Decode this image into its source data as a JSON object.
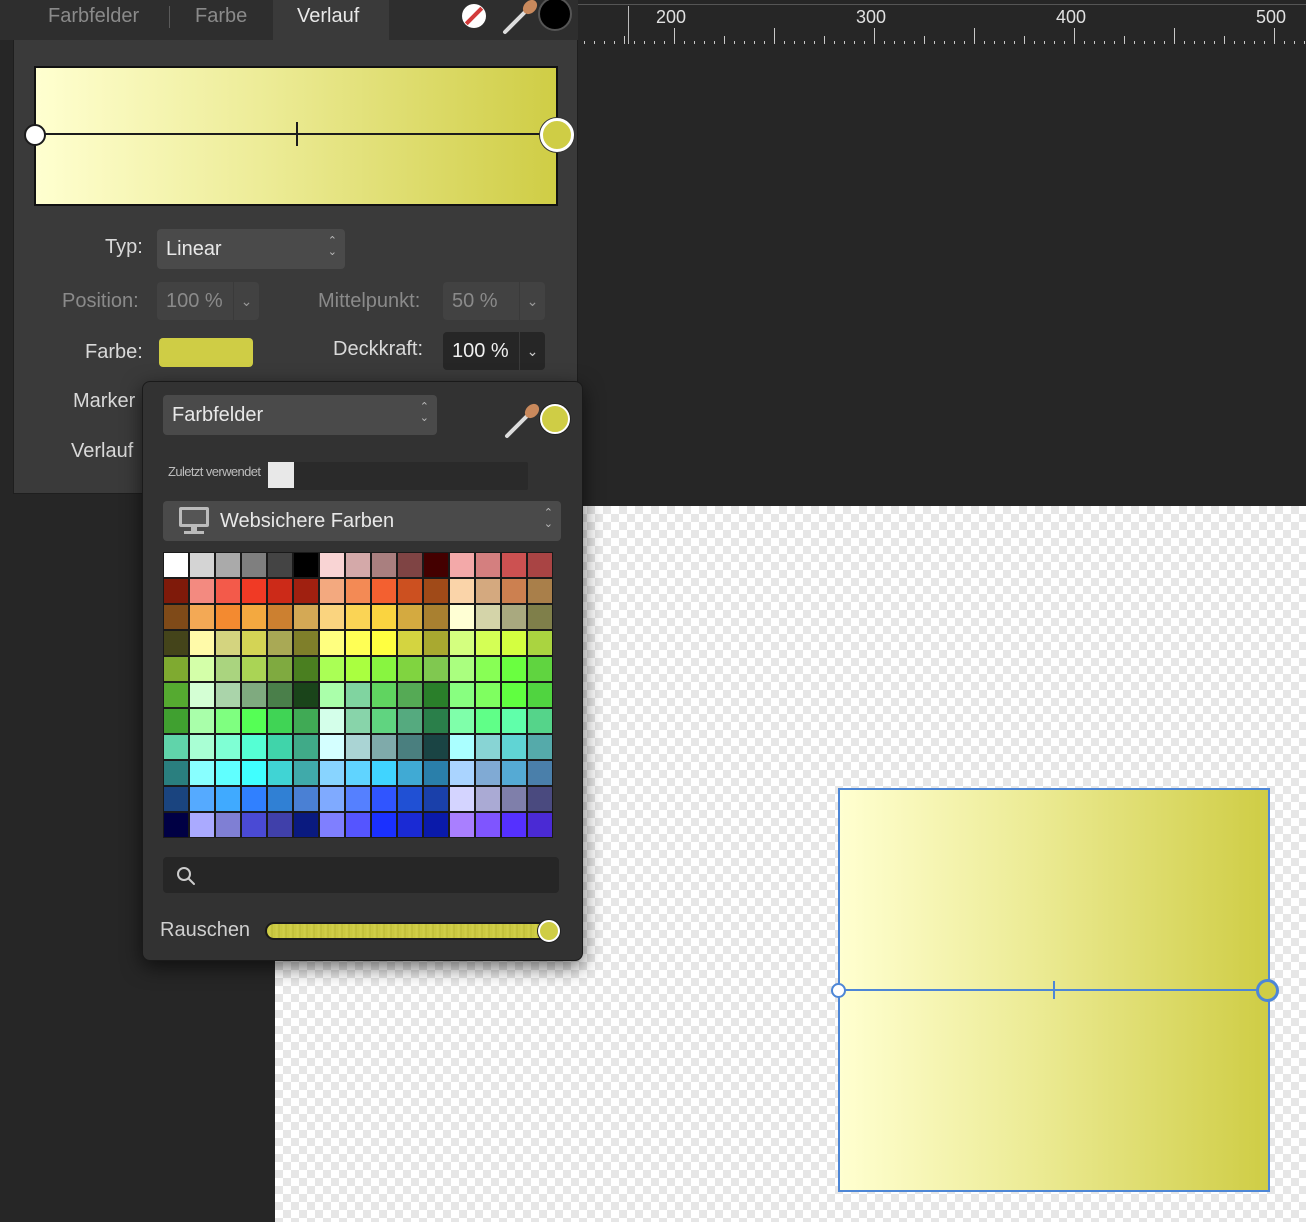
{
  "tabs": [
    {
      "label": "Farbfelder"
    },
    {
      "label": "Farbe"
    },
    {
      "label": "Verlauf"
    }
  ],
  "ruler": {
    "labels": [
      "200",
      "300",
      "400",
      "500"
    ]
  },
  "gradient": {
    "start_color": "#ffffd0",
    "end_color": "#cfcd45",
    "accent_selection": "#4d86d6"
  },
  "form": {
    "typ_label": "Typ:",
    "typ_value": "Linear",
    "position_label": "Position:",
    "position_value": "100 %",
    "mittelpunkt_label": "Mittelpunkt:",
    "mittelpunkt_value": "50 %",
    "farbe_label": "Farbe:",
    "farbe_color": "#cfcd45",
    "deckkraft_label": "Deckkraft:",
    "deckkraft_value": "100 %",
    "marker_label": "Marker",
    "verlauf_label": "Verlauf"
  },
  "popup": {
    "mode_value": "Farbfelder",
    "recent_label": "Zuletzt verwendet",
    "palette_value": "Websichere Farben",
    "search_placeholder": "",
    "noise_label": "Rauschen",
    "current_color": "#cfcd45",
    "swatches": [
      "#ffffff",
      "#d4d4d4",
      "#aaaaaa",
      "#7f7f7f",
      "#444444",
      "#000000",
      "#f9d4d4",
      "#d4a9a9",
      "#a97f7f",
      "#7f4444",
      "#440000",
      "#f3a9a9",
      "#d47f7f",
      "#cc5151",
      "#a94444",
      "#7f1a0a",
      "#f38a80",
      "#f35a4a",
      "#f03a25",
      "#cc2a18",
      "#a02010",
      "#f3a97f",
      "#f38a55",
      "#f36030",
      "#cc5020",
      "#a04a18",
      "#fad4a9",
      "#d4a97f",
      "#cc8050",
      "#a97f4a",
      "#7f4a18",
      "#f3a955",
      "#f38a30",
      "#f3a940",
      "#cc8030",
      "#d4a955",
      "#fad47f",
      "#fad455",
      "#fad440",
      "#d4aa40",
      "#a98030",
      "#ffffd4",
      "#d4d4a9",
      "#a9a97f",
      "#7f7f4a",
      "#44441a",
      "#fffaa9",
      "#d4d47f",
      "#d4d455",
      "#a9a955",
      "#7f7f2a",
      "#ffff7f",
      "#ffff55",
      "#ffff40",
      "#d4d440",
      "#a9a930",
      "#d4ff7f",
      "#d4ff55",
      "#d4ff40",
      "#aad440",
      "#7faa30",
      "#d4ffa9",
      "#aad47f",
      "#aad455",
      "#7faa40",
      "#4a7f20",
      "#aaff55",
      "#aaff40",
      "#88f540",
      "#80d440",
      "#80c850",
      "#aaff7f",
      "#88ff55",
      "#6aff40",
      "#60d440",
      "#55aa30",
      "#d4ffd4",
      "#aad4aa",
      "#7faa7f",
      "#4a7f4a",
      "#1a441a",
      "#aaffaa",
      "#80d4a0",
      "#60d460",
      "#55aa55",
      "#2a7f2a",
      "#88ff80",
      "#7fff60",
      "#60ff40",
      "#50d440",
      "#40a030",
      "#a9ffaa",
      "#7fff80",
      "#55ff55",
      "#40d455",
      "#40aa55",
      "#d4ffea",
      "#88d4aa",
      "#60d480",
      "#55aa7f",
      "#2a7f4a",
      "#7fffaa",
      "#60ff88",
      "#60ffaa",
      "#55d48a",
      "#60d4aa",
      "#a9ffd4",
      "#7fffd4",
      "#55ffd4",
      "#40d4aa",
      "#40aa88",
      "#d4ffff",
      "#aad4d4",
      "#7faaaa",
      "#4a7f7f",
      "#1a4444",
      "#aaffff",
      "#88d4d4",
      "#60d4d4",
      "#55aaaa",
      "#2a7f7f",
      "#88ffff",
      "#60ffff",
      "#40ffff",
      "#40d4d4",
      "#40aaaa",
      "#88d4ff",
      "#60d4ff",
      "#40d4ff",
      "#40aad4",
      "#2a7faa",
      "#aad4ff",
      "#80aad4",
      "#55aad4",
      "#4a7faa",
      "#1a447f",
      "#55aaff",
      "#40aaff",
      "#3080ff",
      "#3080d4",
      "#4a80d4",
      "#7faaff",
      "#5580ff",
      "#3055ff",
      "#2050d4",
      "#1a40aa",
      "#d4d4ff",
      "#aaaad4",
      "#7f7faa",
      "#4a4a7f",
      "#000044",
      "#aaaaff",
      "#7f7fd4",
      "#4a4ad4",
      "#4040aa",
      "#0a1a7f",
      "#7f7fff",
      "#5555ff",
      "#1a30ff",
      "#1a2ad4",
      "#0a1aaa",
      "#a97fff",
      "#7f55ff",
      "#5530ff",
      "#4a2ad4"
    ]
  }
}
